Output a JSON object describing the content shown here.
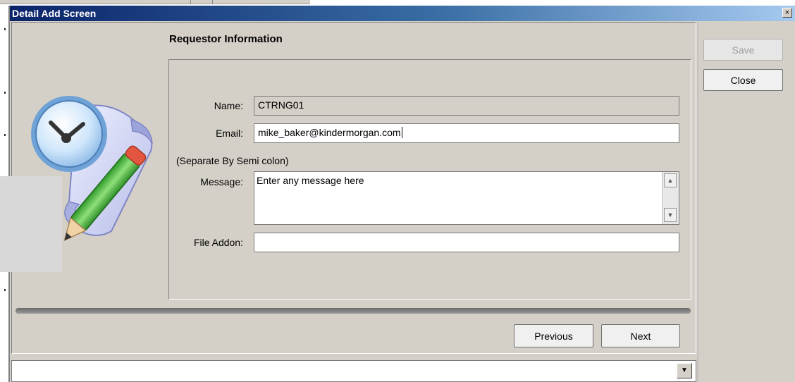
{
  "window": {
    "title": "Detail Add Screen",
    "close_glyph": "×"
  },
  "section": {
    "title": "Requestor Information"
  },
  "form": {
    "name_label": "Name:",
    "name_value": "CTRNG01",
    "email_label": "Email:",
    "email_value": "mike_baker@kindermorgan.com",
    "separator_hint": "(Separate By Semi colon)",
    "message_label": "Message:",
    "message_value": "Enter any message here",
    "file_label": "File Addon:",
    "file_value": ""
  },
  "side_buttons": {
    "save_label": "Save",
    "close_label": "Close"
  },
  "nav_buttons": {
    "previous_label": "Previous",
    "next_label": "Next"
  },
  "combo": {
    "value": ""
  },
  "icons": {
    "illustration": "clock-scroll-pencil-icon",
    "scroll_up": "scroll-up-arrow-icon",
    "scroll_down": "scroll-down-arrow-icon",
    "dropdown": "dropdown-arrow-icon"
  },
  "colors": {
    "titlebar_start": "#0a246a",
    "titlebar_end": "#a6caf0",
    "window_bg": "#d4d0c8"
  }
}
